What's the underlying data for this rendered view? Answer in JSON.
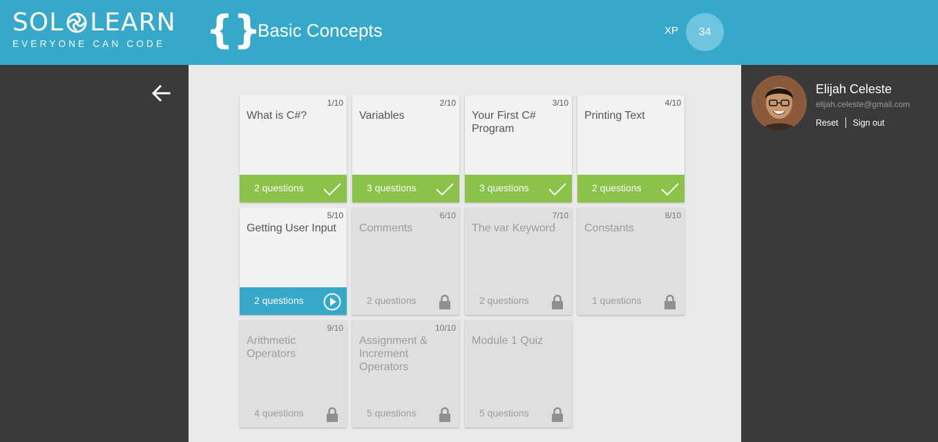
{
  "header": {
    "logo_left": "SOL",
    "logo_right": "LEARN",
    "tagline": "EVERYONE CAN CODE",
    "course_icon": "{}",
    "course_title": "Basic Concepts",
    "xp_label": "XP",
    "xp_value": "34"
  },
  "user": {
    "name": "Elijah Celeste",
    "email": "elijah.celeste@gmail.com",
    "reset_label": "Reset",
    "signout_label": "Sign out"
  },
  "colors": {
    "header": "#36a9cb",
    "done": "#8bc34a",
    "current": "#36a9cb",
    "sidebar": "#3a3a3a",
    "content_bg": "#e9e9e9"
  },
  "lessons": [
    {
      "num": "1/10",
      "title": "What is C#?",
      "questions": "2 questions",
      "status": "done"
    },
    {
      "num": "2/10",
      "title": "Variables",
      "questions": "3 questions",
      "status": "done"
    },
    {
      "num": "3/10",
      "title": "Your First C# Program",
      "questions": "3 questions",
      "status": "done"
    },
    {
      "num": "4/10",
      "title": "Printing Text",
      "questions": "2 questions",
      "status": "done"
    },
    {
      "num": "5/10",
      "title": "Getting User Input",
      "questions": "2 questions",
      "status": "current"
    },
    {
      "num": "6/10",
      "title": "Comments",
      "questions": "2 questions",
      "status": "locked"
    },
    {
      "num": "7/10",
      "title": "The var Keyword",
      "questions": "2 questions",
      "status": "locked"
    },
    {
      "num": "8/10",
      "title": "Constants",
      "questions": "1 questions",
      "status": "locked"
    },
    {
      "num": "9/10",
      "title": "Arithmetic Operators",
      "questions": "4 questions",
      "status": "locked"
    },
    {
      "num": "10/10",
      "title": "Assignment & Increment Operators",
      "questions": "5 questions",
      "status": "locked"
    },
    {
      "num": "",
      "title": "Module 1 Quiz",
      "questions": "5 questions",
      "status": "locked"
    }
  ]
}
